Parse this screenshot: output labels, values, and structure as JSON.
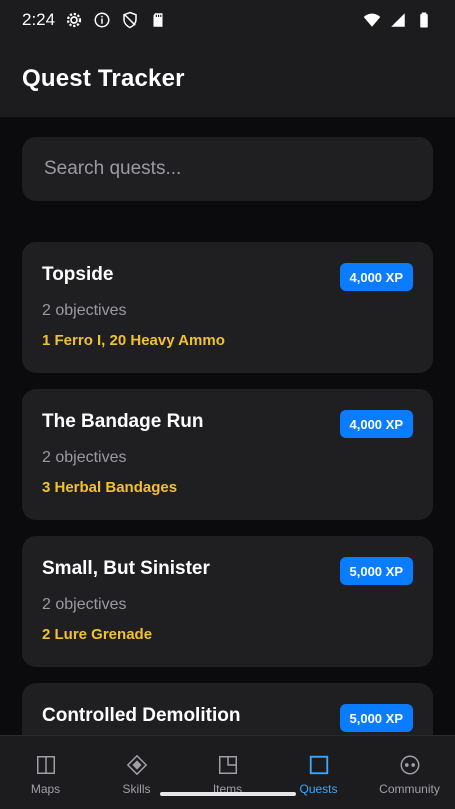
{
  "status_bar": {
    "time": "2:24"
  },
  "app_bar": {
    "title": "Quest Tracker"
  },
  "search": {
    "placeholder": "Search quests..."
  },
  "quests": [
    {
      "title": "Topside",
      "xp": "4,000 XP",
      "objectives": "2 objectives",
      "reward": "1 Ferro I, 20 Heavy Ammo"
    },
    {
      "title": "The Bandage Run",
      "xp": "4,000 XP",
      "objectives": "2 objectives",
      "reward": "3 Herbal Bandages"
    },
    {
      "title": "Small, But Sinister",
      "xp": "5,000 XP",
      "objectives": "2 objectives",
      "reward": "2 Lure Grenade"
    },
    {
      "title": "Controlled Demolition",
      "xp": "5,000 XP",
      "objectives": "",
      "reward": ""
    }
  ],
  "nav": {
    "items": [
      {
        "label": "Maps",
        "icon": "map-icon"
      },
      {
        "label": "Skills",
        "icon": "skills-icon"
      },
      {
        "label": "Items",
        "icon": "items-icon"
      },
      {
        "label": "Quests",
        "icon": "quests-icon",
        "active": true
      },
      {
        "label": "Community",
        "icon": "community-icon"
      }
    ]
  },
  "colors": {
    "accent": "#0a7cff",
    "reward": "#f2c12e",
    "active_tab": "#3aa8ff",
    "card": "#1f1f22",
    "background": "#0b0b0d"
  }
}
